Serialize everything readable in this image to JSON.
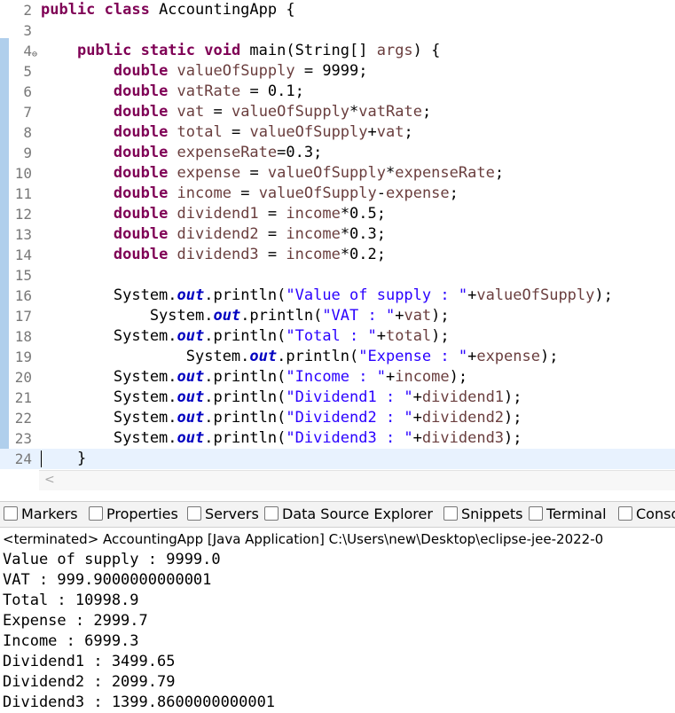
{
  "editor": {
    "lines": [
      {
        "num": "2",
        "parts": [
          [
            "kw",
            "public class "
          ],
          [
            "",
            "AccountingApp {"
          ]
        ]
      },
      {
        "num": "3",
        "parts": []
      },
      {
        "num": "4",
        "fold": "⊖",
        "parts": [
          [
            "",
            "    "
          ],
          [
            "kw",
            "public static void "
          ],
          [
            "",
            "main(String[] "
          ],
          [
            "var",
            "args"
          ],
          [
            "",
            ") {"
          ]
        ]
      },
      {
        "num": "5",
        "parts": [
          [
            "",
            "        "
          ],
          [
            "kw",
            "double "
          ],
          [
            "var",
            "valueOfSupply"
          ],
          [
            "",
            " = 9999;"
          ]
        ]
      },
      {
        "num": "6",
        "parts": [
          [
            "",
            "        "
          ],
          [
            "kw",
            "double "
          ],
          [
            "var",
            "vatRate"
          ],
          [
            "",
            " = 0.1;"
          ]
        ]
      },
      {
        "num": "7",
        "parts": [
          [
            "",
            "        "
          ],
          [
            "kw",
            "double "
          ],
          [
            "var",
            "vat"
          ],
          [
            "",
            " = "
          ],
          [
            "var",
            "valueOfSupply"
          ],
          [
            "",
            "*"
          ],
          [
            "var",
            "vatRate"
          ],
          [
            "",
            ";"
          ]
        ]
      },
      {
        "num": "8",
        "parts": [
          [
            "",
            "        "
          ],
          [
            "kw",
            "double "
          ],
          [
            "var",
            "total"
          ],
          [
            "",
            " = "
          ],
          [
            "var",
            "valueOfSupply"
          ],
          [
            "",
            "+"
          ],
          [
            "var",
            "vat"
          ],
          [
            "",
            ";"
          ]
        ]
      },
      {
        "num": "9",
        "parts": [
          [
            "",
            "        "
          ],
          [
            "kw",
            "double "
          ],
          [
            "var",
            "expenseRate"
          ],
          [
            "",
            "=0.3;"
          ]
        ]
      },
      {
        "num": "10",
        "parts": [
          [
            "",
            "        "
          ],
          [
            "kw",
            "double "
          ],
          [
            "var",
            "expense"
          ],
          [
            "",
            " = "
          ],
          [
            "var",
            "valueOfSupply"
          ],
          [
            "",
            "*"
          ],
          [
            "var",
            "expenseRate"
          ],
          [
            "",
            ";"
          ]
        ]
      },
      {
        "num": "11",
        "parts": [
          [
            "",
            "        "
          ],
          [
            "kw",
            "double "
          ],
          [
            "var",
            "income"
          ],
          [
            "",
            " = "
          ],
          [
            "var",
            "valueOfSupply"
          ],
          [
            "",
            "-"
          ],
          [
            "var",
            "expense"
          ],
          [
            "",
            ";"
          ]
        ]
      },
      {
        "num": "12",
        "parts": [
          [
            "",
            "        "
          ],
          [
            "kw",
            "double "
          ],
          [
            "var",
            "dividend1"
          ],
          [
            "",
            " = "
          ],
          [
            "var",
            "income"
          ],
          [
            "",
            "*0.5;"
          ]
        ]
      },
      {
        "num": "13",
        "parts": [
          [
            "",
            "        "
          ],
          [
            "kw",
            "double "
          ],
          [
            "var",
            "dividend2"
          ],
          [
            "",
            " = "
          ],
          [
            "var",
            "income"
          ],
          [
            "",
            "*0.3;"
          ]
        ]
      },
      {
        "num": "14",
        "parts": [
          [
            "",
            "        "
          ],
          [
            "kw",
            "double "
          ],
          [
            "var",
            "dividend3"
          ],
          [
            "",
            " = "
          ],
          [
            "var",
            "income"
          ],
          [
            "",
            "*0.2;"
          ]
        ]
      },
      {
        "num": "15",
        "parts": []
      },
      {
        "num": "16",
        "parts": [
          [
            "",
            "        System."
          ],
          [
            "fld",
            "out"
          ],
          [
            "",
            ".println("
          ],
          [
            "str",
            "\"Value of supply : \""
          ],
          [
            "",
            "+"
          ],
          [
            "var",
            "valueOfSupply"
          ],
          [
            "",
            ");"
          ]
        ]
      },
      {
        "num": "17",
        "parts": [
          [
            "",
            "            System."
          ],
          [
            "fld",
            "out"
          ],
          [
            "",
            ".println("
          ],
          [
            "str",
            "\"VAT : \""
          ],
          [
            "",
            "+"
          ],
          [
            "var",
            "vat"
          ],
          [
            "",
            ");"
          ]
        ]
      },
      {
        "num": "18",
        "parts": [
          [
            "",
            "        System."
          ],
          [
            "fld",
            "out"
          ],
          [
            "",
            ".println("
          ],
          [
            "str",
            "\"Total : \""
          ],
          [
            "",
            "+"
          ],
          [
            "var",
            "total"
          ],
          [
            "",
            ");"
          ]
        ]
      },
      {
        "num": "19",
        "parts": [
          [
            "",
            "                System."
          ],
          [
            "fld",
            "out"
          ],
          [
            "",
            ".println("
          ],
          [
            "str",
            "\"Expense : \""
          ],
          [
            "",
            "+"
          ],
          [
            "var",
            "expense"
          ],
          [
            "",
            ");"
          ]
        ]
      },
      {
        "num": "20",
        "parts": [
          [
            "",
            "        System."
          ],
          [
            "fld",
            "out"
          ],
          [
            "",
            ".println("
          ],
          [
            "str",
            "\"Income : \""
          ],
          [
            "",
            "+"
          ],
          [
            "var",
            "income"
          ],
          [
            "",
            ");"
          ]
        ]
      },
      {
        "num": "21",
        "parts": [
          [
            "",
            "        System."
          ],
          [
            "fld",
            "out"
          ],
          [
            "",
            ".println("
          ],
          [
            "str",
            "\"Dividend1 : \""
          ],
          [
            "",
            "+"
          ],
          [
            "var",
            "dividend1"
          ],
          [
            "",
            ");"
          ]
        ]
      },
      {
        "num": "22",
        "parts": [
          [
            "",
            "        System."
          ],
          [
            "fld",
            "out"
          ],
          [
            "",
            ".println("
          ],
          [
            "str",
            "\"Dividend2 : \""
          ],
          [
            "",
            "+"
          ],
          [
            "var",
            "dividend2"
          ],
          [
            "",
            ");"
          ]
        ]
      },
      {
        "num": "23",
        "parts": [
          [
            "",
            "        System."
          ],
          [
            "fld",
            "out"
          ],
          [
            "",
            ".println("
          ],
          [
            "str",
            "\"Dividend3 : \""
          ],
          [
            "",
            "+"
          ],
          [
            "var",
            "dividend3"
          ],
          [
            "",
            ");"
          ]
        ]
      },
      {
        "num": "24",
        "current": true,
        "parts": [
          [
            "",
            "    }"
          ]
        ]
      }
    ]
  },
  "scroll_arrow": "<",
  "tabs": [
    {
      "label": "Markers",
      "icon": "markers-icon"
    },
    {
      "label": "Properties",
      "icon": "properties-icon"
    },
    {
      "label": "Servers",
      "icon": "servers-icon"
    },
    {
      "label": "Data Source Explorer",
      "icon": "data-source-icon"
    },
    {
      "label": "Snippets",
      "icon": "snippets-icon"
    },
    {
      "label": "Terminal",
      "icon": "terminal-icon"
    },
    {
      "label": "Conso",
      "icon": "console-icon"
    }
  ],
  "console": {
    "header": "<terminated> AccountingApp [Java Application] C:\\Users\\new\\Desktop\\eclipse-jee-2022-0",
    "output": [
      "Value of supply : 9999.0",
      "VAT : 999.9000000000001",
      "Total : 10998.9",
      "Expense : 2999.7",
      "Income : 6999.3",
      "Dividend1 : 3499.65",
      "Dividend2 : 2099.79",
      "Dividend3 : 1399.8600000000001"
    ]
  }
}
